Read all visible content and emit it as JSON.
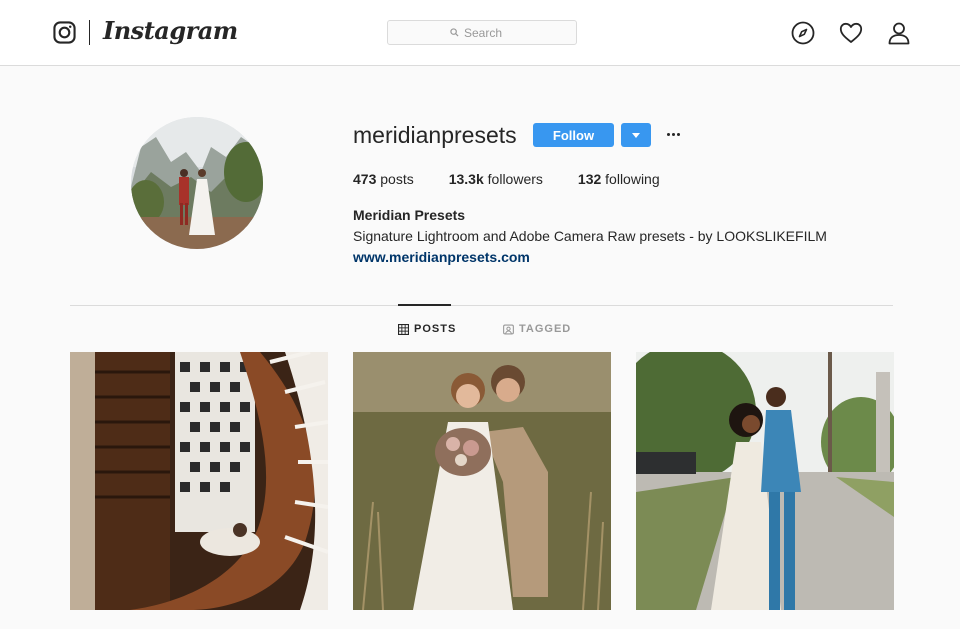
{
  "nav": {
    "logo_icon": "instagram-glyph-icon",
    "wordmark": "Instagram",
    "search_placeholder": "Search",
    "icons": [
      "compass-icon",
      "heart-icon",
      "person-icon"
    ]
  },
  "profile": {
    "username": "meridianpresets",
    "follow_label": "Follow",
    "stats": [
      {
        "value": "473",
        "label": "posts"
      },
      {
        "value": "13.3k",
        "label": "followers"
      },
      {
        "value": "132",
        "label": "following"
      }
    ],
    "full_name": "Meridian Presets",
    "bio": "Signature Lightroom and Adobe Camera Raw presets - by LOOKSLIKEFILM",
    "website": "www.meridianpresets.com"
  },
  "tabs": [
    {
      "label": "POSTS",
      "active": true,
      "icon": "grid-icon"
    },
    {
      "label": "TAGGED",
      "active": false,
      "icon": "tag-icon"
    }
  ],
  "posts": [
    {
      "subject": "spiral-staircase-couple"
    },
    {
      "subject": "bride-groom-meadow"
    },
    {
      "subject": "couple-street-trees"
    }
  ],
  "colors": {
    "accent": "#3897f0",
    "link": "#003569",
    "text": "#262626",
    "muted": "#999999",
    "border": "#dbdbdb",
    "background": "#fafafa"
  }
}
